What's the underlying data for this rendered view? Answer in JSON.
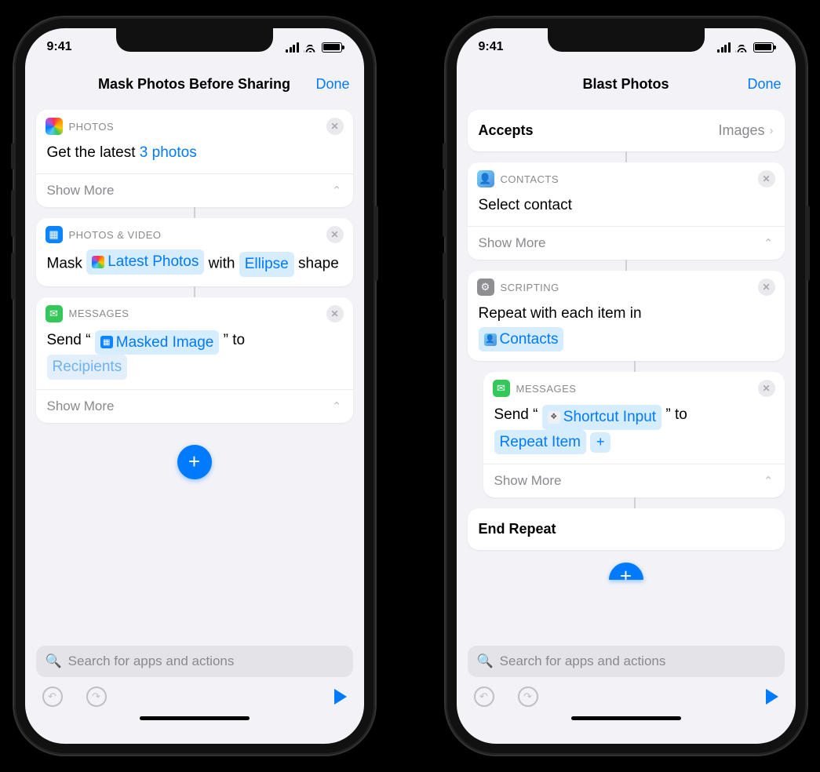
{
  "status": {
    "time": "9:41"
  },
  "left": {
    "title": "Mask Photos Before Sharing",
    "done": "Done",
    "photos": {
      "category": "PHOTOS",
      "line_a": "Get the latest",
      "count_token": "3 photos",
      "show_more": "Show More"
    },
    "mask": {
      "category": "PHOTOS & VIDEO",
      "word_mask": "Mask",
      "token_latest": "Latest Photos",
      "word_with": "with",
      "token_ellipse": "Ellipse",
      "word_shape": "shape"
    },
    "messages": {
      "category": "MESSAGES",
      "word_send": "Send",
      "quote_open": "“",
      "token_masked": "Masked Image",
      "quote_close": "”",
      "word_to": "to",
      "token_recipients": "Recipients",
      "show_more": "Show More"
    }
  },
  "right": {
    "title": "Blast Photos",
    "done": "Done",
    "accepts": {
      "label": "Accepts",
      "value": "Images"
    },
    "contacts": {
      "category": "CONTACTS",
      "line": "Select contact",
      "show_more": "Show More"
    },
    "repeat": {
      "category": "SCRIPTING",
      "line": "Repeat with each item in",
      "token_contacts": "Contacts"
    },
    "messages": {
      "category": "MESSAGES",
      "word_send": "Send",
      "quote_open": "“",
      "token_input": "Shortcut Input",
      "quote_close": "”",
      "word_to": "to",
      "token_repeat_item": "Repeat Item",
      "show_more": "Show More"
    },
    "end_repeat": "End Repeat"
  },
  "search_placeholder": "Search for apps and actions"
}
